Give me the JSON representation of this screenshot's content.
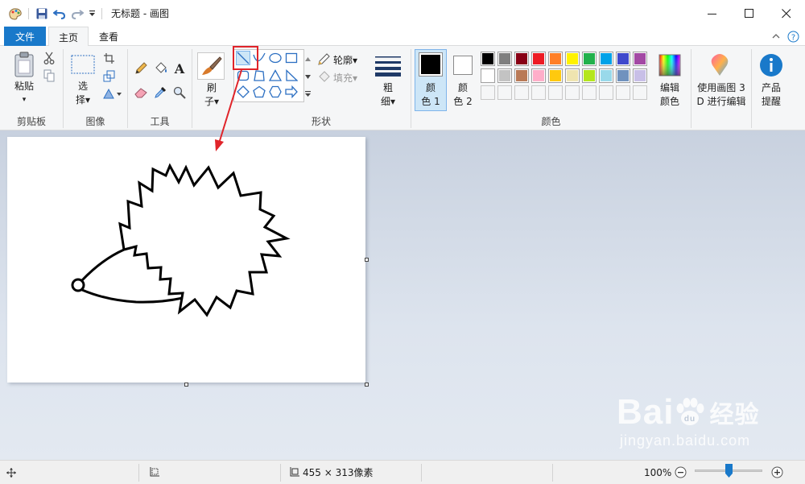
{
  "window": {
    "title": "无标题 - 画图",
    "minimize_icon": "minimize-icon",
    "maximize_icon": "maximize-icon",
    "close_icon": "close-icon"
  },
  "quick_access": [
    "paint-app-icon",
    "save-icon",
    "undo-icon",
    "redo-icon",
    "customize-dropdown-icon"
  ],
  "tabs": {
    "file": "文件",
    "home": "主页",
    "view": "查看"
  },
  "ribbon": {
    "clipboard": {
      "group_label": "剪贴板",
      "paste_line1": "粘贴",
      "paste_line2": "▾"
    },
    "image": {
      "group_label": "图像",
      "select_line1": "选",
      "select_line2": "择▾"
    },
    "tools": {
      "group_label": "工具"
    },
    "brushes": {
      "label_line1": "刷",
      "label_line2": "子▾"
    },
    "shapes": {
      "group_label": "形状",
      "outline_label": "轮廓▾",
      "fill_label": "填充▾"
    },
    "size": {
      "label_line1": "粗",
      "label_line2": "细▾"
    },
    "colors": {
      "group_label": "颜色",
      "color1_line1": "颜",
      "color1_line2": "色 1",
      "color2_line1": "颜",
      "color2_line2": "色 2",
      "edit_line1": "编辑",
      "edit_line2": "颜色",
      "color1_value": "#000000",
      "color2_value": "#ffffff",
      "palette_row1": [
        "#000000",
        "#7f7f7f",
        "#880015",
        "#ed1c24",
        "#ff7f27",
        "#fff200",
        "#22b14c",
        "#00a2e8",
        "#3f48cc",
        "#a349a4"
      ],
      "palette_row2": [
        "#ffffff",
        "#c3c3c3",
        "#b97a57",
        "#ffaec9",
        "#ffc90e",
        "#efe4b0",
        "#b5e61d",
        "#99d9ea",
        "#7092be",
        "#c8bfe7"
      ]
    },
    "paint3d": {
      "line1": "使用画图 3",
      "line2": "D 进行编辑"
    },
    "product_alert": {
      "line1": "产品",
      "line2": "提醒"
    }
  },
  "status": {
    "image_size": "455 × 313像素",
    "zoom": "100%"
  },
  "watermark": {
    "brand": "Bai",
    "brand_cn": "经验",
    "url": "jingyan.baidu.com"
  },
  "accent_color": "#1979ca",
  "annotation_color": "#e0242a"
}
